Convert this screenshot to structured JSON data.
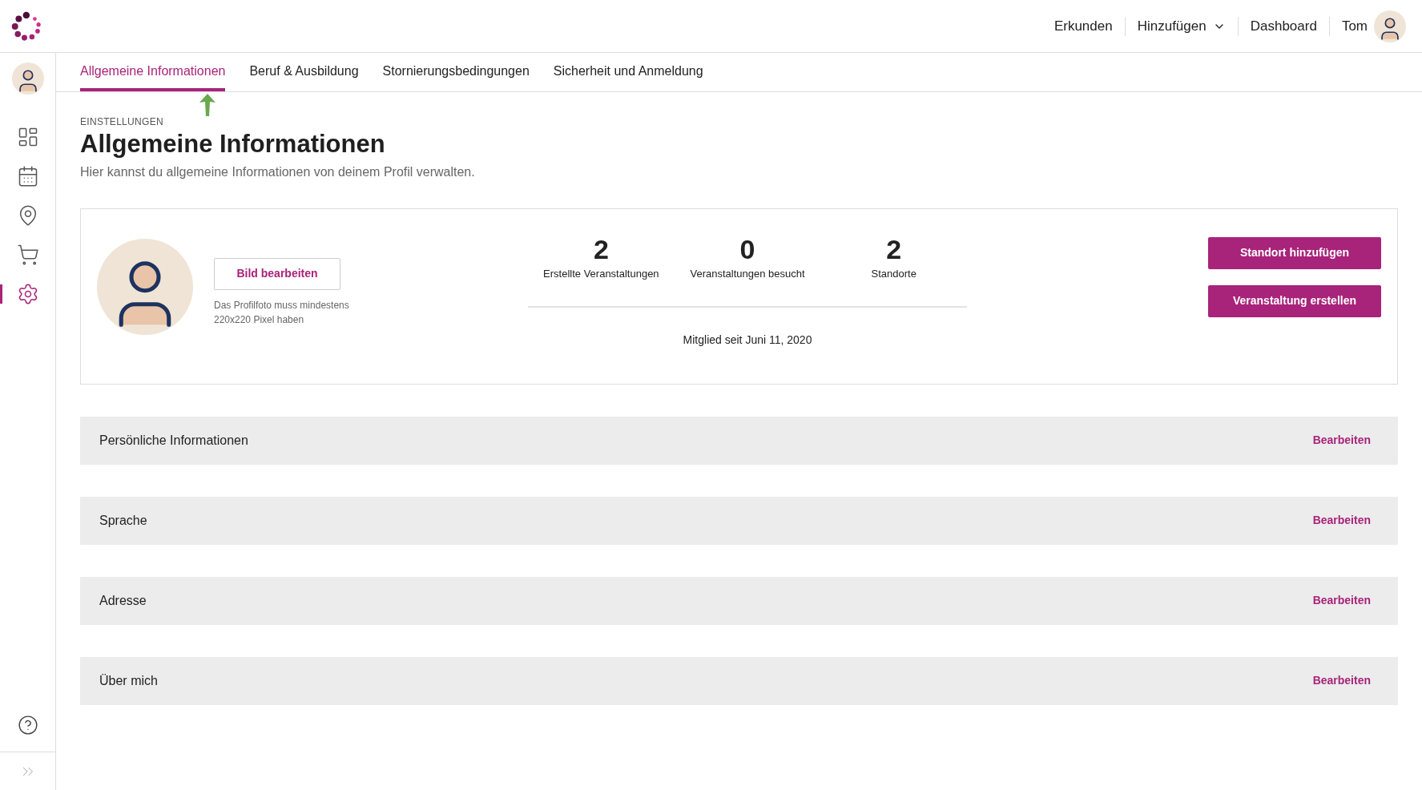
{
  "header": {
    "nav": [
      {
        "label": "Erkunden",
        "kind": "link"
      },
      {
        "label": "Hinzufügen",
        "kind": "dropdown"
      },
      {
        "label": "Dashboard",
        "kind": "link"
      }
    ],
    "user": {
      "name": "Tom"
    }
  },
  "sidebar": {
    "items": [
      {
        "kind": "dashboard",
        "selected": false
      },
      {
        "kind": "calendar",
        "selected": false
      },
      {
        "kind": "location",
        "selected": false
      },
      {
        "kind": "cart",
        "selected": false
      },
      {
        "kind": "settings",
        "selected": true
      }
    ]
  },
  "tabs": [
    {
      "label": "Allgemeine Informationen",
      "selected": true
    },
    {
      "label": "Beruf & Ausbildung",
      "selected": false
    },
    {
      "label": "Stornierungsbedingungen",
      "selected": false
    },
    {
      "label": "Sicherheit und Anmeldung",
      "selected": false
    }
  ],
  "page": {
    "eyebrow": "EINSTELLUNGEN",
    "title": "Allgemeine Informationen",
    "subtitle": "Hier kannst du allgemeine Informationen von deinem Profil verwalten."
  },
  "profile": {
    "edit_button": "Bild bearbeiten",
    "hint": "Das Profilfoto muss mindestens 220x220 Pixel haben",
    "stats": [
      {
        "value": "2",
        "label": "Erstellte Veranstaltungen"
      },
      {
        "value": "0",
        "label": "Veranstaltungen besucht"
      },
      {
        "value": "2",
        "label": "Standorte"
      }
    ],
    "member_since": "Mitglied seit Juni 11, 2020",
    "actions": [
      "Standort hinzufügen",
      "Veranstaltung erstellen"
    ]
  },
  "sections": [
    {
      "title": "Persönliche Informationen",
      "action": "Bearbeiten"
    },
    {
      "title": "Sprache",
      "action": "Bearbeiten"
    },
    {
      "title": "Adresse",
      "action": "Bearbeiten"
    },
    {
      "title": "Über mich",
      "action": "Bearbeiten"
    }
  ]
}
